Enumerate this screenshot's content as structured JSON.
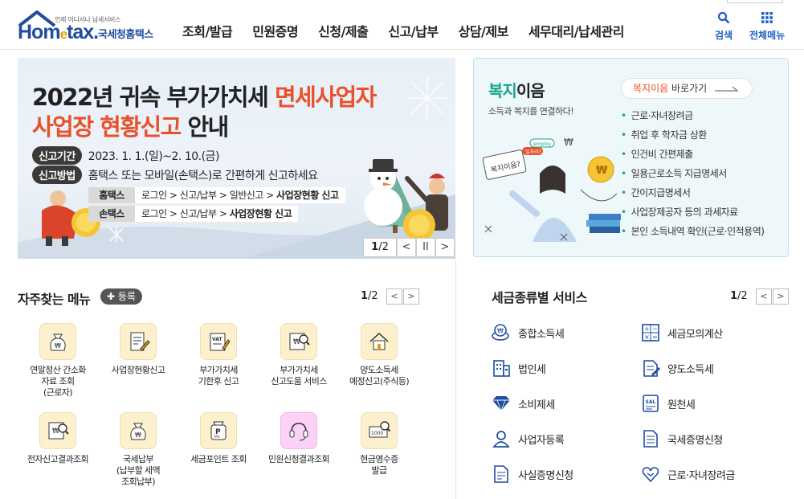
{
  "header": {
    "logo_small": "언제 어디서나 납세서비스",
    "logo_home": "Hom",
    "logo_e": "e",
    "logo_tax": "tax.",
    "logo_nts": "국세청홈택스",
    "nav": [
      "조회/발급",
      "민원증명",
      "신청/제출",
      "신고/납부",
      "상담/제보",
      "세무대리/납세관리"
    ],
    "search_label": "검색",
    "all_menu_label": "전체메뉴"
  },
  "banner": {
    "title_line1_a": "2022년 귀속 부가가치세 ",
    "title_line1_b": "면세사업자",
    "title_line2_a": "사업장 현황신고",
    "title_line2_b": " 안내",
    "period_tag": "신고기간",
    "period_text": "2023. 1. 1.(일)~2. 10.(금)",
    "method_tag": "신고방법",
    "method_text": "홈택스 또는 모바일(손택스)로 간편하게 신고하세요",
    "route1_tag": "홈택스",
    "route1_path": "로그인 > 신고/납부 > 일반신고 > ",
    "route1_bold": "사업장현황 신고",
    "route2_tag": "손택스",
    "route2_path": "로그인 > 신고/납부 > ",
    "route2_bold": "사업장현황 신고",
    "page_current": "1",
    "page_total": "/2",
    "prev": "<",
    "pause": "II",
    "next": ">"
  },
  "welfare": {
    "title_a": "복지",
    "title_b": "이음",
    "subtitle": "소득과 복지를 연결하다!",
    "goto_accent": "복지이음",
    "goto_text": " 바로가기",
    "items": [
      "근로·자녀장려금",
      "취업 후 학자금 상환",
      "인건비 간편제출",
      "일용근로소득 지급명세서",
      "간이지급명세서",
      "사업장제공자 등의 과세자료",
      "본인 소득내역 확인(근로·인적용역)"
    ],
    "illustration_text_1": "복지이음?",
    "illustration_text_2": "employ",
    "illustration_text_3": "일자리?"
  },
  "frequent": {
    "title": "자주찾는 메뉴",
    "register_label": "등록",
    "page_current": "1",
    "page_total": "/2",
    "items": [
      {
        "label": "연말정산 간소화\n자료 조회\n(근로자)",
        "icon": "money-bag-icon"
      },
      {
        "label": "사업장현황신고",
        "icon": "document-edit-icon"
      },
      {
        "label": "부가가치세\n기한후 신고",
        "icon": "vat-document-icon"
      },
      {
        "label": "부가가치세\n신고도움 서비스",
        "icon": "won-search-icon"
      },
      {
        "label": "양도소득세\n예정신고(주식등)",
        "icon": "house-icon"
      },
      {
        "label": "전자신고결과조회",
        "icon": "won-search-icon"
      },
      {
        "label": "국세납부\n(납부할 세액\n조회납부)",
        "icon": "money-bag-icon"
      },
      {
        "label": "세금포인트 조회",
        "icon": "tax-bag-icon"
      },
      {
        "label": "민원신청결과조회",
        "icon": "headset-icon"
      },
      {
        "label": "현금영수증\n발급",
        "icon": "receipt-search-icon"
      }
    ],
    "icon_text_vat": "VAT",
    "icon_text_won": "₩",
    "icon_text_p": "P",
    "icon_text_tax": "TAX",
    "icon_text_1000": "1000"
  },
  "tax_services": {
    "title": "세금종류별 서비스",
    "page_current": "1",
    "page_total": "/2",
    "items": [
      {
        "label": "종합소득세",
        "icon": "coins-icon"
      },
      {
        "label": "세금모의계산",
        "icon": "calculator-icon"
      },
      {
        "label": "법인세",
        "icon": "building-icon"
      },
      {
        "label": "양도소득세",
        "icon": "transfer-document-icon"
      },
      {
        "label": "소비제세",
        "icon": "diamond-icon"
      },
      {
        "label": "원천세",
        "icon": "sal-receipt-icon"
      },
      {
        "label": "사업자등록",
        "icon": "person-icon"
      },
      {
        "label": "국세증명신청",
        "icon": "certificate-icon"
      },
      {
        "label": "사실증명신청",
        "icon": "document-icon"
      },
      {
        "label": "근로·자녀장려금",
        "icon": "heart-icon"
      }
    ],
    "icon_text_sal": "SAL"
  },
  "colors": {
    "brand_blue": "#1f4d9e",
    "accent_orange": "#e8512a",
    "welfare_green": "#17a38d",
    "icon_bg": "#fdf0cc"
  }
}
